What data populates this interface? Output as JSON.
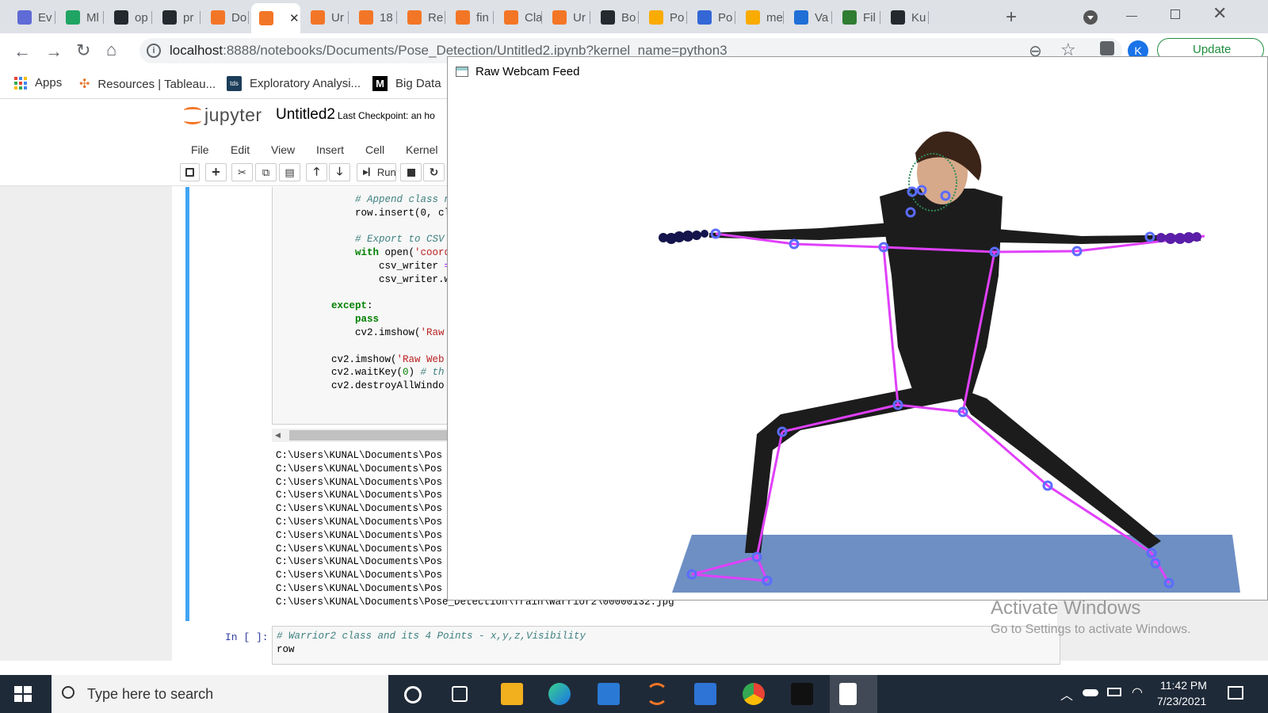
{
  "browser": {
    "tabs": [
      {
        "label": "Ev",
        "icon": "calendar-icon",
        "color": "#5f6bd6"
      },
      {
        "label": "Ml",
        "icon": "drive-icon",
        "color": "#1fa463"
      },
      {
        "label": "op",
        "icon": "github-icon",
        "color": "#24292e"
      },
      {
        "label": "pr",
        "icon": "github-icon",
        "color": "#24292e"
      },
      {
        "label": "Do",
        "icon": "jupyter-icon",
        "color": "#f37626"
      },
      {
        "label": "",
        "icon": "hourglass-icon",
        "color": "#f37626"
      },
      {
        "label": "Ur",
        "icon": "notebook-icon",
        "color": "#f37626"
      },
      {
        "label": "18",
        "icon": "notebook-icon",
        "color": "#f37626"
      },
      {
        "label": "Re",
        "icon": "notebook-icon",
        "color": "#f37626"
      },
      {
        "label": "fin",
        "icon": "notebook-icon",
        "color": "#f37626"
      },
      {
        "label": "Cla",
        "icon": "notebook-icon",
        "color": "#f37626"
      },
      {
        "label": "Ur",
        "icon": "notebook-icon",
        "color": "#f37626"
      },
      {
        "label": "Bo",
        "icon": "github-icon",
        "color": "#24292e"
      },
      {
        "label": "Po",
        "icon": "colab-icon",
        "color": "#f9ab00"
      },
      {
        "label": "Po",
        "icon": "code-icon",
        "color": "#3367d6"
      },
      {
        "label": "me",
        "icon": "colab-icon",
        "color": "#f9ab00"
      },
      {
        "label": "Va",
        "icon": "d-icon",
        "color": "#1f6fd6"
      },
      {
        "label": "Fil",
        "icon": "link-icon",
        "color": "#2e7d32"
      },
      {
        "label": "Ku",
        "icon": "github-icon",
        "color": "#24292e"
      }
    ],
    "new_tab": "+",
    "url_host": "localhost",
    "url_rest": ":8888/notebooks/Documents/Pose_Detection/Untitled2.ipynb?kernel_name=python3",
    "profile_initial": "K",
    "update_label": "Update",
    "bookmarks": [
      {
        "label": "Apps",
        "icon": "apps-grid-icon"
      },
      {
        "label": "Resources | Tableau...",
        "icon": "tableau-icon"
      },
      {
        "label": "Exploratory Analysi...",
        "icon": "tds-icon",
        "badge": "tds"
      },
      {
        "label": "Big Data",
        "icon": "medium-icon",
        "badge": "M"
      }
    ]
  },
  "jupyter": {
    "logo_text": "jupyter",
    "notebook_name": "Untitled2",
    "checkpoint": "Last Checkpoint: an ho",
    "menu": [
      "File",
      "Edit",
      "View",
      "Insert",
      "Cell",
      "Kernel"
    ],
    "run_label": "Run",
    "code_lines": [
      [
        {
          "t": "    # Append class n",
          "c": "cm"
        }
      ],
      [
        {
          "t": "    row.insert(0, cl",
          "c": ""
        }
      ],
      [
        {
          "t": "",
          "c": ""
        }
      ],
      [
        {
          "t": "    # Export to CSV",
          "c": "cm"
        }
      ],
      [
        {
          "t": "    ",
          "c": ""
        },
        {
          "t": "with",
          "c": "kw"
        },
        {
          "t": " open(",
          "c": ""
        },
        {
          "t": "'coord",
          "c": "st"
        }
      ],
      [
        {
          "t": "        csv_writer ",
          "c": ""
        },
        {
          "t": "=",
          "c": "op"
        }
      ],
      [
        {
          "t": "        csv_writer.w",
          "c": ""
        }
      ],
      [
        {
          "t": "",
          "c": ""
        }
      ],
      [
        {
          "t": "except",
          "c": "kw"
        },
        {
          "t": ":",
          "c": ""
        }
      ],
      [
        {
          "t": "    ",
          "c": ""
        },
        {
          "t": "pass",
          "c": "kw"
        }
      ],
      [
        {
          "t": "    cv2.imshow(",
          "c": ""
        },
        {
          "t": "'Raw ",
          "c": "st"
        }
      ],
      [
        {
          "t": "",
          "c": ""
        }
      ],
      [
        {
          "t": "cv2.imshow(",
          "c": ""
        },
        {
          "t": "'Raw Web",
          "c": "st"
        }
      ],
      [
        {
          "t": "cv2.waitKey(",
          "c": ""
        },
        {
          "t": "0",
          "c": "nm"
        },
        {
          "t": ") ",
          "c": ""
        },
        {
          "t": "# th",
          "c": "cm"
        }
      ],
      [
        {
          "t": "cv2.destroyAllWindo",
          "c": ""
        }
      ]
    ],
    "output_lines": [
      "C:\\Users\\KUNAL\\Documents\\Pos",
      "C:\\Users\\KUNAL\\Documents\\Pos",
      "C:\\Users\\KUNAL\\Documents\\Pos",
      "C:\\Users\\KUNAL\\Documents\\Pos",
      "C:\\Users\\KUNAL\\Documents\\Pos",
      "C:\\Users\\KUNAL\\Documents\\Pos",
      "C:\\Users\\KUNAL\\Documents\\Pos",
      "C:\\Users\\KUNAL\\Documents\\Pos",
      "C:\\Users\\KUNAL\\Documents\\Pos",
      "C:\\Users\\KUNAL\\Documents\\Pos",
      "C:\\Users\\KUNAL\\Documents\\Pos",
      "C:\\Users\\KUNAL\\Documents\\Pose_Detection\\Train\\Warrior2\\00000132.jpg"
    ],
    "next_prompt": "In [ ]:",
    "next_cell_line1": "# Warrior2 class and its 4 Points - x,y,z,Visibility",
    "next_cell_line2": "row"
  },
  "cv_window": {
    "title": "Raw Webcam Feed"
  },
  "watermark": {
    "line1": "Activate Windows",
    "line2": "Go to Settings to activate Windows."
  },
  "taskbar": {
    "search_placeholder": "Type here to search",
    "time": "11:42 PM",
    "date": "7/23/2021",
    "apps": [
      "cortana-icon",
      "task-view-icon",
      "file-explorer-icon",
      "edge-icon",
      "mail-icon",
      "jupyter-icon",
      "store-icon",
      "chrome-icon",
      "intellij-icon",
      "notepad-icon"
    ]
  }
}
